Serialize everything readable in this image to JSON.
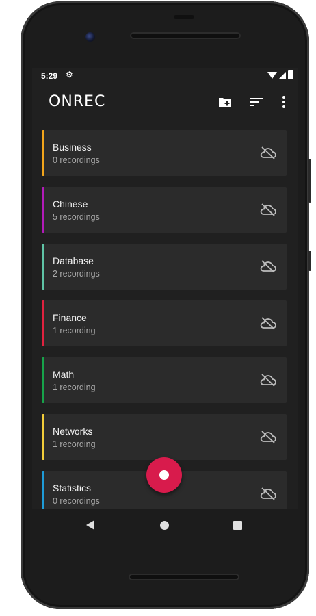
{
  "status_bar": {
    "time": "5:29"
  },
  "app_bar": {
    "title": "ONREC"
  },
  "folders": [
    {
      "name": "Business",
      "count": "0 recordings",
      "color": "#f2a51b"
    },
    {
      "name": "Chinese",
      "count": "5 recordings",
      "color": "#b21bb8"
    },
    {
      "name": "Database",
      "count": "2 recordings",
      "color": "#5fc4a6"
    },
    {
      "name": "Finance",
      "count": "1 recording",
      "color": "#e0223f"
    },
    {
      "name": "Math",
      "count": "1 recording",
      "color": "#17a34a"
    },
    {
      "name": "Networks",
      "count": "1 recording",
      "color": "#f2cd3a"
    },
    {
      "name": "Statistics",
      "count": "0 recordings",
      "color": "#1e9bd7"
    }
  ],
  "colors": {
    "background": "#202020",
    "card": "#2b2b2b",
    "fab": "#d81b4c"
  },
  "icons": [
    "gear-icon",
    "wifi-icon",
    "signal-icon",
    "battery-icon",
    "new-folder-icon",
    "sort-icon",
    "more-vert-icon",
    "cloud-off-icon",
    "record-icon",
    "back-icon",
    "home-icon",
    "recents-icon"
  ]
}
